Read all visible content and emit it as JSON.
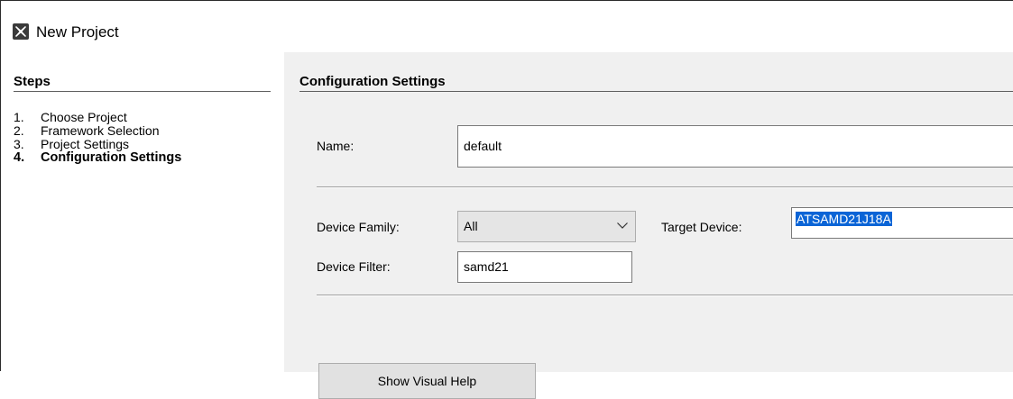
{
  "window": {
    "title": "New Project",
    "icon": "app-logo-icon"
  },
  "steps": {
    "heading": "Steps",
    "items": [
      {
        "num": "1.",
        "label": "Choose Project",
        "active": false
      },
      {
        "num": "2.",
        "label": "Framework Selection",
        "active": false
      },
      {
        "num": "3.",
        "label": "Project Settings",
        "active": false
      },
      {
        "num": "4.",
        "label": "Configuration Settings",
        "active": true
      }
    ]
  },
  "config": {
    "heading": "Configuration Settings",
    "name_label": "Name:",
    "name_value": "default",
    "device_family_label": "Device Family:",
    "device_family_value": "All",
    "target_device_label": "Target Device:",
    "target_device_value": "ATSAMD21J18A",
    "device_filter_label": "Device Filter:",
    "device_filter_value": "samd21",
    "show_visual_help_label": "Show Visual Help"
  },
  "colors": {
    "panel_bg": "#f0f0f0",
    "selection": "#0a64d6"
  }
}
